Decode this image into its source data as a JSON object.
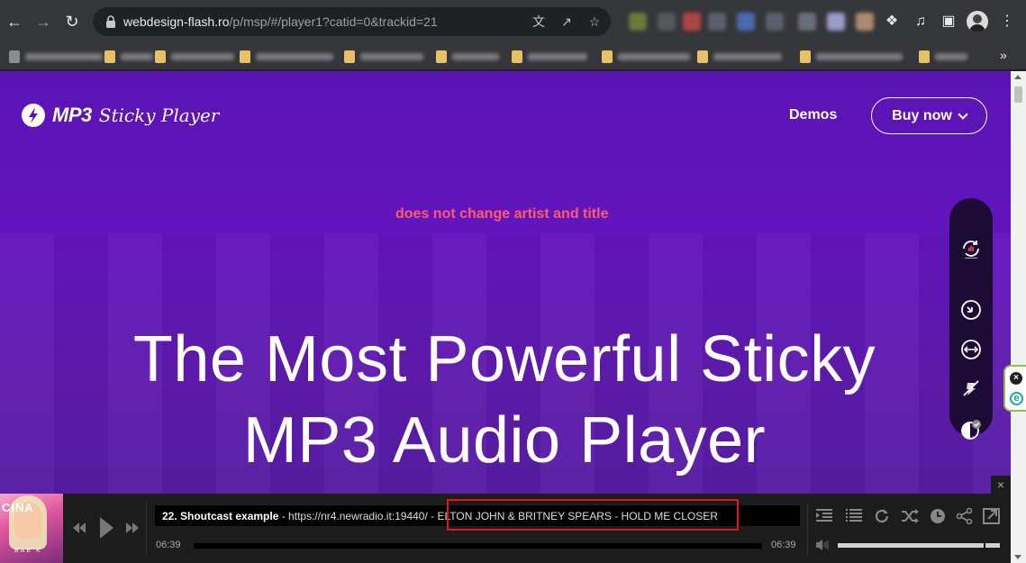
{
  "browser": {
    "url_host": "webdesign-flash.ro",
    "url_path": "/p/msp/#/player1?catid=0&trackid=21"
  },
  "site": {
    "logo_mp3": "MP3",
    "logo_sticky": "Sticky Player",
    "nav_demos": "Demos",
    "nav_buy": "Buy now",
    "annotation": "does not change artist and title",
    "hero_line1": "The Most Powerful Sticky",
    "hero_line2": "MP3 Audio Player"
  },
  "player": {
    "cover_title": "CINA",
    "cover_sub": "BAE K",
    "track_number": "22. Shoutcast example",
    "track_url": " - https://nr4.newradio.it:19440/",
    "track_meta": " - ELTON JOHN & BRITNEY SPEARS - HOLD ME CLOSER",
    "time_current": "06:39",
    "time_total": "06:39",
    "volume": 0.9
  },
  "colors": {
    "page_purple": "#5a14b4",
    "annotation_red": "#ff5c6a",
    "highlight_red": "#e0191b"
  }
}
